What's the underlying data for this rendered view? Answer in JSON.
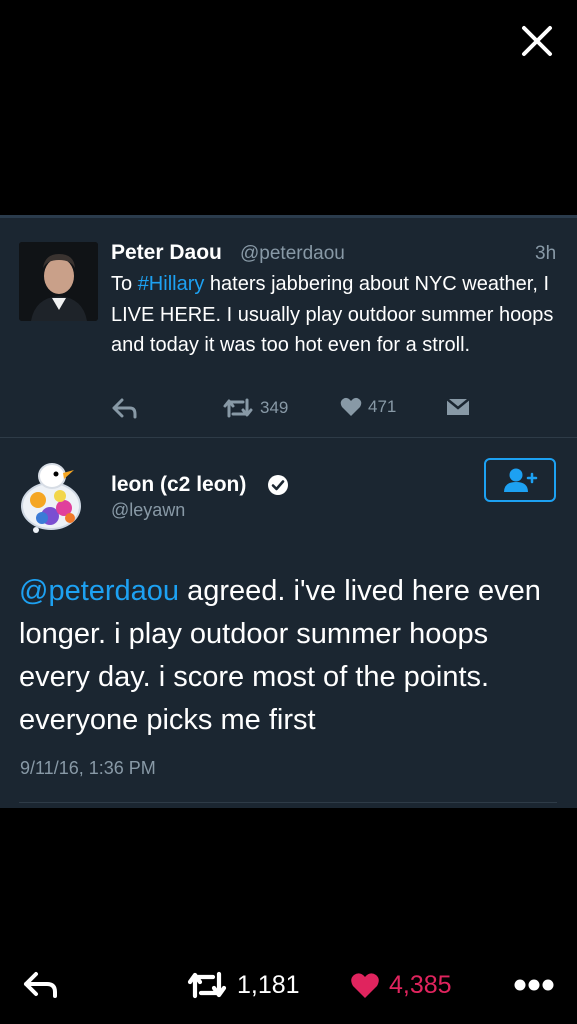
{
  "toolbar": {
    "close_icon": "close-icon"
  },
  "parent_tweet": {
    "name": "Peter Daou",
    "handle": "@peterdaou",
    "time": "3h",
    "text_before": "To ",
    "hashtag": "#Hillary",
    "text_after": " haters jabbering about NYC weather, I LIVE HERE. I usually play outdoor summer hoops and today it was too hot even for a stroll.",
    "retweets": "349",
    "likes": "471",
    "icons": [
      "reply-icon",
      "retweet-icon",
      "like-icon",
      "message-icon"
    ]
  },
  "main_tweet": {
    "name": "leon (c2 leon)",
    "handle": "@leyawn",
    "mention": "@peterdaou",
    "text": " agreed. i've lived here even longer. i play outdoor summer hoops every day. i score most of the points. everyone picks me first",
    "timestamp": "9/11/16, 1:36 PM",
    "verified": true,
    "follow_icon": "follow-user-icon"
  },
  "bottom_bar": {
    "retweets": "1,181",
    "likes": "4,385",
    "like_color": "#e0245e",
    "icons": [
      "reply-icon",
      "retweet-icon",
      "like-icon",
      "more-icon"
    ]
  },
  "colors": {
    "accent": "#1da1f2",
    "panel": "#1b2631",
    "muted": "#8899a6"
  }
}
